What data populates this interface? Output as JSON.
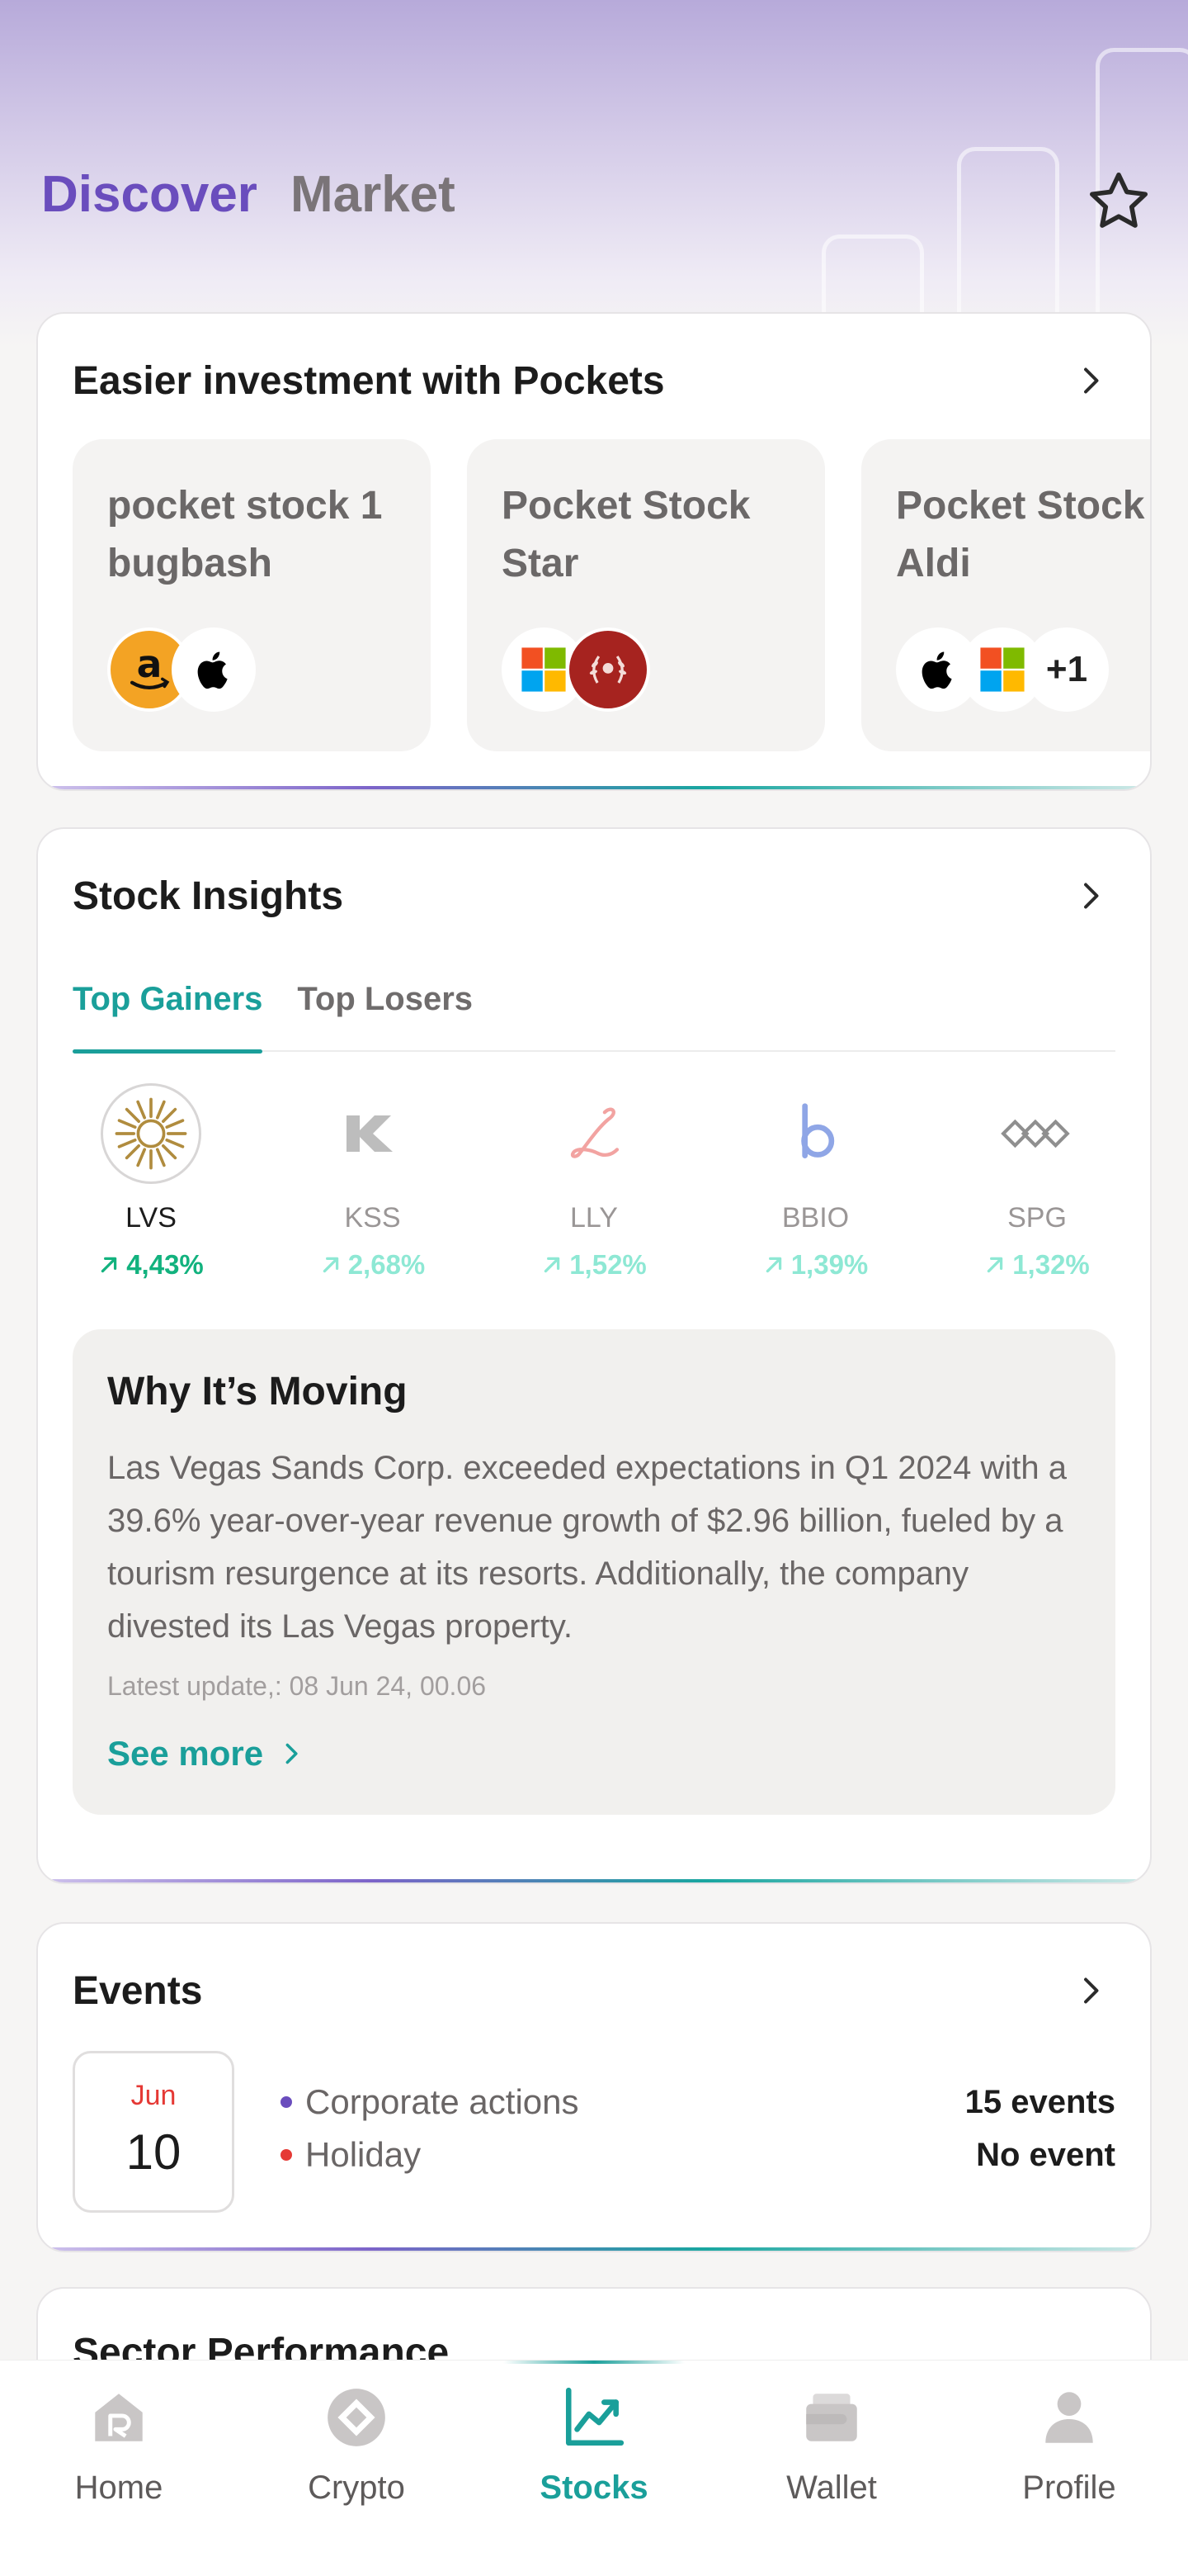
{
  "header": {
    "tabs": [
      {
        "label": "Discover",
        "active": true
      },
      {
        "label": "Market",
        "active": false
      }
    ],
    "favorites_icon": "star-outline-icon"
  },
  "pockets": {
    "title": "Easier investment with Pockets",
    "items": [
      {
        "name": "pocket stock 1 bugbash",
        "logos": [
          "amazon-logo",
          "apple-logo"
        ]
      },
      {
        "name": "Pocket Stock Star",
        "logos": [
          "microsoft-logo",
          "laurel-logo"
        ]
      },
      {
        "name": "Pocket Stock Aldi",
        "logos": [
          "apple-logo",
          "microsoft-logo"
        ],
        "more": "+1"
      }
    ]
  },
  "insights": {
    "title": "Stock Insights",
    "tabs": [
      {
        "label": "Top Gainers",
        "active": true
      },
      {
        "label": "Top Losers",
        "active": false
      }
    ],
    "gainers": [
      {
        "ticker": "LVS",
        "change": "4,43%",
        "selected": true
      },
      {
        "ticker": "KSS",
        "change": "2,68%"
      },
      {
        "ticker": "LLY",
        "change": "1,52%"
      },
      {
        "ticker": "BBIO",
        "change": "1,39%"
      },
      {
        "ticker": "SPG",
        "change": "1,32%"
      }
    ],
    "why_moving": {
      "title": "Why It’s Moving",
      "body": "Las Vegas Sands Corp. exceeded expectations in Q1 2024 with a 39.6% year-over-year revenue growth of $2.96 billion, fueled by a tourism resurgence at its resorts. Additionally, the company divested its Las Vegas property.",
      "update": "Latest update,: 08 Jun 24, 00.06",
      "see_more": "See more"
    }
  },
  "events": {
    "title": "Events",
    "date": {
      "month": "Jun",
      "day": "10"
    },
    "lines": [
      {
        "label": "Corporate actions",
        "count": "15 events",
        "color": "#6a4dbd"
      },
      {
        "label": "Holiday",
        "count": "No event",
        "color": "#e53935"
      }
    ]
  },
  "sector": {
    "title": "Sector Performance"
  },
  "nav": [
    {
      "label": "Home",
      "icon": "home-icon"
    },
    {
      "label": "Crypto",
      "icon": "crypto-icon"
    },
    {
      "label": "Stocks",
      "icon": "stocks-chart-icon",
      "active": true
    },
    {
      "label": "Wallet",
      "icon": "wallet-icon"
    },
    {
      "label": "Profile",
      "icon": "profile-icon"
    }
  ],
  "colors": {
    "brand_purple": "#6a4dbd",
    "accent_teal": "#1a9f9a",
    "gain_green": "#12b27e",
    "holiday_red": "#e53935"
  }
}
